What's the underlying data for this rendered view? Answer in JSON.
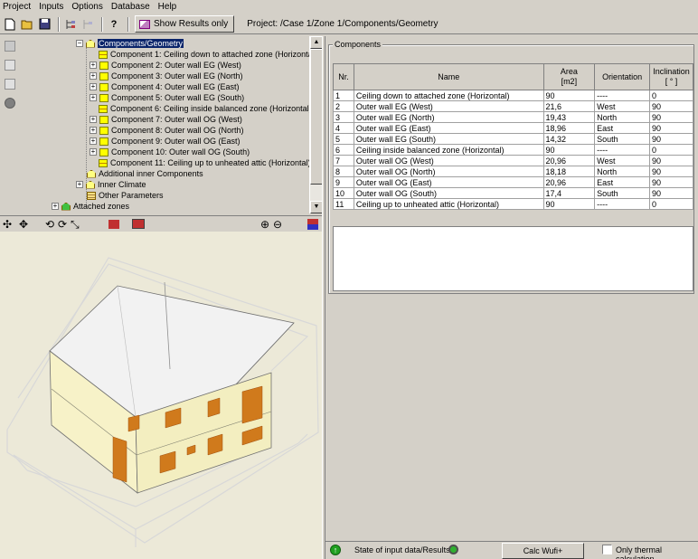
{
  "menu": [
    "Project",
    "Inputs",
    "Options",
    "Database",
    "Help"
  ],
  "toolbar": {
    "show_results_label": "Show Results only",
    "project_path": "Project: /Case 1/Zone 1/Components/Geometry"
  },
  "tree": {
    "root_label": "Components/Geometry",
    "components": [
      "Component 1: Ceiling down to attached zone (Horizontal)",
      "Component 2: Outer wall EG (West)",
      "Component 3: Outer wall EG (North)",
      "Component 4: Outer wall EG (East)",
      "Component 5: Outer wall EG (South)",
      "Component 6: Ceiling inside balanced zone (Horizontal)",
      "Component 7: Outer wall OG (West)",
      "Component 8: Outer wall OG (North)",
      "Component 9: Outer wall OG (East)",
      "Component 10: Outer wall OG (South)",
      "Component 11: Ceiling up to unheated attic (Horizontal)"
    ],
    "additional_inner": "Additional inner Components",
    "inner_climate": "Inner Climate",
    "other_parameters": "Other Parameters",
    "attached_zones": "Attached zones"
  },
  "components_panel": {
    "group_title": "Components",
    "headers": {
      "nr": "Nr.",
      "name": "Name",
      "area_line1": "Area",
      "area_line2": "[m2]",
      "orientation": "Orientation",
      "inclination_line1": "Inclination",
      "inclination_line2": "[ ° ]"
    },
    "rows": [
      {
        "nr": "1",
        "name": "Ceiling down to attached zone (Horizontal)",
        "area": "90",
        "orientation": "----",
        "inclination": "0"
      },
      {
        "nr": "2",
        "name": "Outer wall EG (West)",
        "area": "21,6",
        "orientation": "West",
        "inclination": "90"
      },
      {
        "nr": "3",
        "name": "Outer wall EG (North)",
        "area": "19,43",
        "orientation": "North",
        "inclination": "90"
      },
      {
        "nr": "4",
        "name": "Outer wall EG (East)",
        "area": "18,96",
        "orientation": "East",
        "inclination": "90"
      },
      {
        "nr": "5",
        "name": "Outer wall EG (South)",
        "area": "14,32",
        "orientation": "South",
        "inclination": "90"
      },
      {
        "nr": "6",
        "name": "Ceiling inside balanced zone (Horizontal)",
        "area": "90",
        "orientation": "----",
        "inclination": "0"
      },
      {
        "nr": "7",
        "name": "Outer wall OG (West)",
        "area": "20,96",
        "orientation": "West",
        "inclination": "90"
      },
      {
        "nr": "8",
        "name": "Outer wall OG (North)",
        "area": "18,18",
        "orientation": "North",
        "inclination": "90"
      },
      {
        "nr": "9",
        "name": "Outer wall OG (East)",
        "area": "20,96",
        "orientation": "East",
        "inclination": "90"
      },
      {
        "nr": "10",
        "name": "Outer wall OG (South)",
        "area": "17,4",
        "orientation": "South",
        "inclination": "90"
      },
      {
        "nr": "11",
        "name": "Ceiling up to unheated attic (Horizontal)",
        "area": "90",
        "orientation": "----",
        "inclination": "0"
      }
    ]
  },
  "statusbar": {
    "state_label": "State of input data/Results",
    "calc_button": "Calc Wufi+",
    "thermal_only_label": "Only thermal calculation"
  },
  "colors": {
    "selection": "#0a246a",
    "wall": "#f7f2c8",
    "roof": "#e8e8e8",
    "window": "#d07a1c"
  }
}
